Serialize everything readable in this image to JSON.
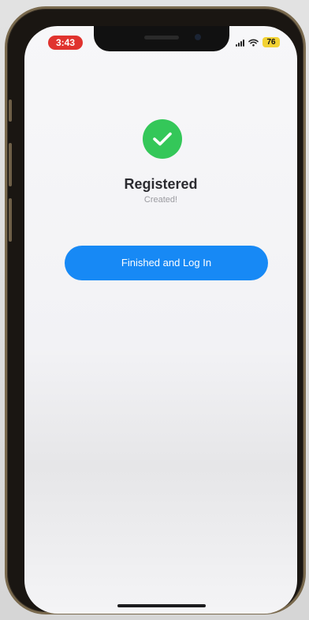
{
  "status_bar": {
    "time": "3:43",
    "battery": "76",
    "icons": [
      "signal-icon",
      "wifi-icon",
      "battery-icon"
    ]
  },
  "main": {
    "success_icon": "checkmark-circle-icon",
    "title": "Registered",
    "subtitle": "Created!",
    "button_label": "Finished and Log In"
  },
  "colors": {
    "success": "#34c759",
    "accent": "#1789f5",
    "time_pill": "#e0332e",
    "battery": "#f2d233"
  }
}
